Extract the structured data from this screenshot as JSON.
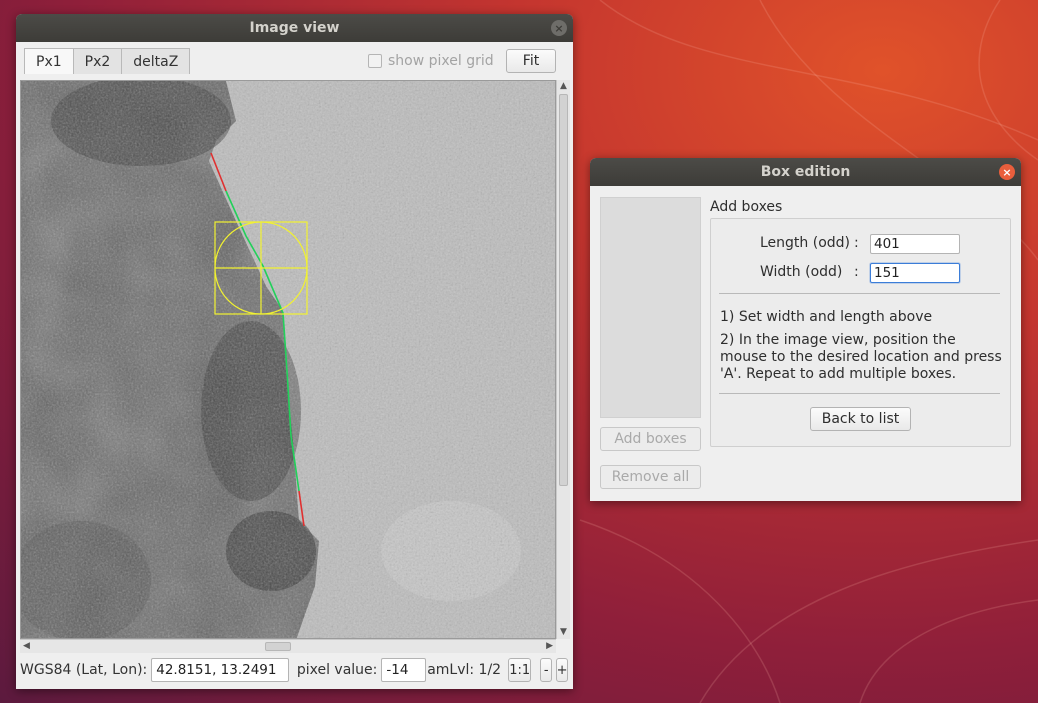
{
  "image_view": {
    "title": "Image view",
    "close_icon": "×",
    "tabs": [
      {
        "label": "Px1",
        "active": true
      },
      {
        "label": "Px2",
        "active": false
      },
      {
        "label": "deltaZ",
        "active": false
      }
    ],
    "show_pixel_grid_label": "show pixel grid",
    "show_pixel_grid_checked": false,
    "fit_label": "Fit",
    "status": {
      "coord_label": "WGS84 (Lat, Lon):",
      "coord_value": "42.8151, 13.2491",
      "pixel_label": "pixel value:",
      "pixel_value": "-14",
      "zoom_label": "amLvl: 1/2",
      "one_to_one": "1:1",
      "minus": "-",
      "plus": "+"
    }
  },
  "box_edition": {
    "title": "Box edition",
    "close_icon": "×",
    "group_title": "Add boxes",
    "length_label": "Length (odd)",
    "length_value": "401",
    "width_label": "Width (odd)",
    "width_value": "151",
    "colon": ":",
    "instruction_1": "1) Set width and length above",
    "instruction_2": "2) In the image view, position the mouse to the desired location and press 'A'. Repeat to add multiple boxes.",
    "back_label": "Back to list",
    "add_boxes_label": "Add boxes",
    "remove_all_label": "Remove all"
  },
  "colors": {
    "trace_green": "#22d05a",
    "trace_red": "#e03030",
    "box_yellow": "#f2f230",
    "titlebar": "#3d3c38",
    "close_orange": "#e95e3c"
  }
}
